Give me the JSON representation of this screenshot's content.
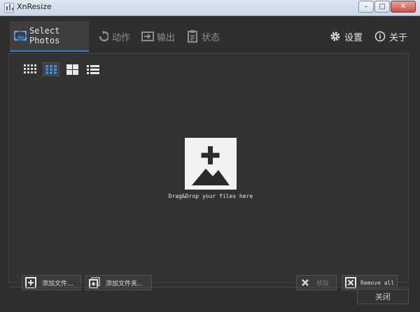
{
  "window": {
    "title": "XnResize"
  },
  "tabs": [
    {
      "label": "Select Photos",
      "icon": "select-photos-icon"
    },
    {
      "label": "动作",
      "icon": "action-icon"
    },
    {
      "label": "输出",
      "icon": "output-icon"
    },
    {
      "label": "状态",
      "icon": "status-icon"
    }
  ],
  "header_right": [
    {
      "label": "设置",
      "icon": "gear-icon"
    },
    {
      "label": "关于",
      "icon": "info-icon"
    }
  ],
  "view_modes": [
    "small-grid-icon",
    "medium-grid-icon",
    "large-grid-icon",
    "list-icon"
  ],
  "active_view_mode": 1,
  "drop_zone": {
    "text": "Drag&Drop your files here",
    "icon": "add-image-icon"
  },
  "buttons": {
    "add_files": "添加文件...",
    "add_folder": "添加文件夹...",
    "remove": "移除",
    "remove_all": "Remove all",
    "close": "关闭"
  },
  "colors": {
    "accent": "#3a78c5",
    "background": "#2f2f2f",
    "drop_zone": "#f2f2f2"
  }
}
